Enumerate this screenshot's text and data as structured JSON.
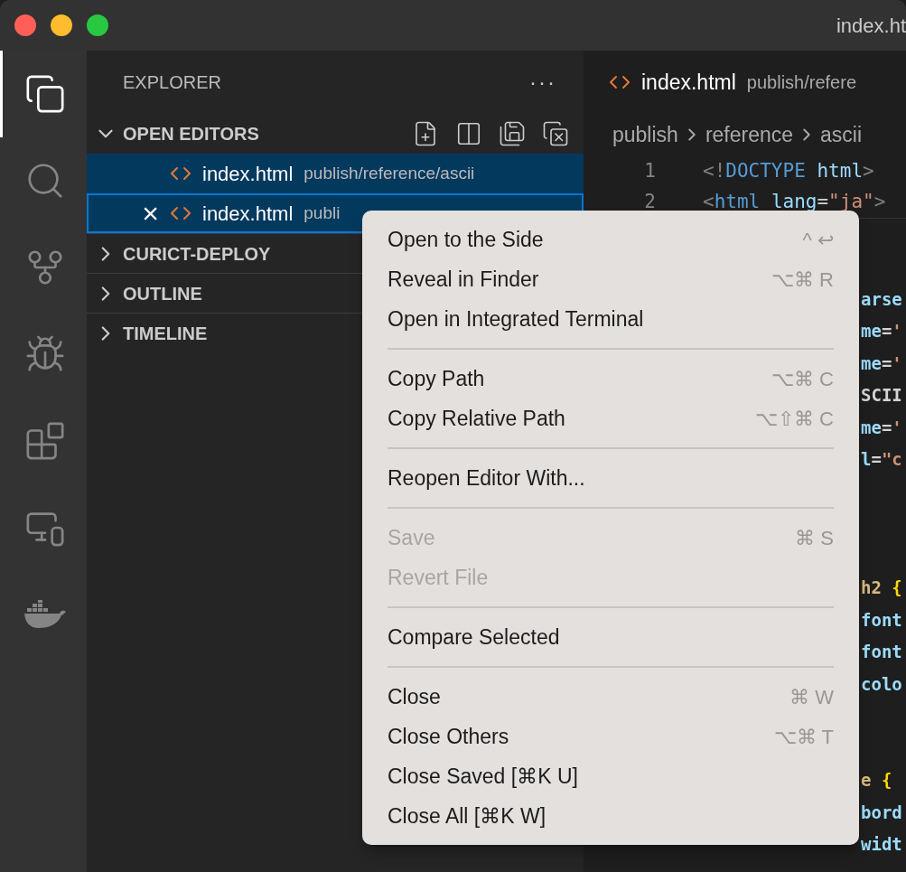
{
  "window": {
    "title": "index.ht"
  },
  "activity_bar": [
    {
      "kind": "explorer",
      "selected": true
    },
    {
      "kind": "search",
      "selected": false
    },
    {
      "kind": "git",
      "selected": false
    },
    {
      "kind": "debug",
      "selected": false
    },
    {
      "kind": "extensions",
      "selected": false
    },
    {
      "kind": "remote",
      "selected": false
    },
    {
      "kind": "docker",
      "selected": false
    }
  ],
  "sidebar": {
    "title": "EXPLORER",
    "more": "···",
    "open_editors": {
      "title": "OPEN EDITORS",
      "expanded": true,
      "items": [
        {
          "name": "index.html",
          "path": "publish/reference/ascii",
          "selected": true,
          "focused": false
        },
        {
          "name": "index.html",
          "path": "publi",
          "selected": true,
          "focused": true,
          "close": "×"
        }
      ]
    },
    "sections": [
      {
        "title": "CURICT-DEPLOY",
        "expanded": false
      },
      {
        "title": "OUTLINE",
        "expanded": false
      },
      {
        "title": "TIMELINE",
        "expanded": false
      }
    ]
  },
  "editor": {
    "tab": {
      "name": "index.html",
      "path": "publish/refere"
    },
    "breadcrumbs": [
      "publish",
      "reference",
      "ascii"
    ],
    "lines": [
      {
        "kind": "full",
        "number": "1",
        "tokens": [
          {
            "text": "<!",
            "color": "#808080"
          },
          {
            "text": "DOCTYPE",
            "color": "#569cd6"
          },
          {
            "text": " html",
            "color": "#9cdcfe"
          },
          {
            "text": ">",
            "color": "#808080"
          }
        ]
      },
      {
        "kind": "full",
        "number": "2",
        "tokens": [
          {
            "text": "<",
            "color": "#808080"
          },
          {
            "text": "html",
            "color": "#569cd6"
          },
          {
            "text": " lang",
            "color": "#9cdcfe"
          },
          {
            "text": "=",
            "color": "#d4d4d4"
          },
          {
            "text": "\"ja\"",
            "color": "#ce9178"
          },
          {
            "text": ">",
            "color": "#808080"
          }
        ]
      },
      {
        "kind": "blank"
      },
      {
        "kind": "blank"
      },
      {
        "kind": "fragment",
        "tokens": [
          {
            "text": "arse",
            "color": "#9cdcfe"
          }
        ]
      },
      {
        "kind": "fragment",
        "tokens": [
          {
            "text": "me",
            "color": "#9cdcfe"
          },
          {
            "text": "=",
            "color": "#d4d4d4"
          },
          {
            "text": "'",
            "color": "#ce9178"
          }
        ]
      },
      {
        "kind": "fragment",
        "tokens": [
          {
            "text": "me",
            "color": "#9cdcfe"
          },
          {
            "text": "=",
            "color": "#d4d4d4"
          },
          {
            "text": "'",
            "color": "#ce9178"
          }
        ]
      },
      {
        "kind": "fragment",
        "tokens": [
          {
            "text": "SCII",
            "color": "#d4d4d4"
          }
        ]
      },
      {
        "kind": "fragment",
        "tokens": [
          {
            "text": "me",
            "color": "#9cdcfe"
          },
          {
            "text": "=",
            "color": "#d4d4d4"
          },
          {
            "text": "'",
            "color": "#ce9178"
          }
        ]
      },
      {
        "kind": "fragment",
        "tokens": [
          {
            "text": "l",
            "color": "#9cdcfe"
          },
          {
            "text": "=",
            "color": "#d4d4d4"
          },
          {
            "text": "\"c",
            "color": "#ce9178"
          }
        ]
      },
      {
        "kind": "blank"
      },
      {
        "kind": "blank"
      },
      {
        "kind": "blank"
      },
      {
        "kind": "fragment",
        "tokens": [
          {
            "text": "h2 ",
            "color": "#d7ba7d"
          },
          {
            "text": "{",
            "color": "#ffd700"
          }
        ]
      },
      {
        "kind": "fragment",
        "tokens": [
          {
            "text": "font",
            "color": "#9cdcfe"
          }
        ]
      },
      {
        "kind": "fragment",
        "tokens": [
          {
            "text": "font",
            "color": "#9cdcfe"
          }
        ]
      },
      {
        "kind": "fragment",
        "tokens": [
          {
            "text": "colo",
            "color": "#9cdcfe"
          }
        ]
      },
      {
        "kind": "blank"
      },
      {
        "kind": "blank"
      },
      {
        "kind": "fragment",
        "tokens": [
          {
            "text": "e ",
            "color": "#d7ba7d"
          },
          {
            "text": "{",
            "color": "#ffd700"
          }
        ]
      },
      {
        "kind": "fragment",
        "tokens": [
          {
            "text": "bord",
            "color": "#9cdcfe"
          }
        ]
      },
      {
        "kind": "fragment",
        "tokens": [
          {
            "text": "widt",
            "color": "#9cdcfe"
          }
        ]
      }
    ]
  },
  "context_menu": {
    "groups": [
      [
        {
          "label": "Open to the Side",
          "shortcut": "^ ↩",
          "disabled": false
        },
        {
          "label": "Reveal in Finder",
          "shortcut": "⌥⌘ R",
          "disabled": false
        },
        {
          "label": "Open in Integrated Terminal",
          "disabled": false
        }
      ],
      [
        {
          "label": "Copy Path",
          "shortcut": "⌥⌘ C",
          "disabled": false
        },
        {
          "label": "Copy Relative Path",
          "shortcut": "⌥⇧⌘ C",
          "disabled": false
        }
      ],
      [
        {
          "label": "Reopen Editor With...",
          "disabled": false
        }
      ],
      [
        {
          "label": "Save",
          "shortcut": "⌘ S",
          "disabled": true
        },
        {
          "label": "Revert File",
          "disabled": true
        }
      ],
      [
        {
          "label": "Compare Selected",
          "disabled": false
        }
      ],
      [
        {
          "label": "Close",
          "shortcut": "⌘ W",
          "disabled": false
        },
        {
          "label": "Close Others",
          "shortcut": "⌥⌘ T",
          "disabled": false
        },
        {
          "label": "Close Saved [⌘K U]",
          "disabled": false
        },
        {
          "label": "Close All [⌘K W]",
          "disabled": false
        }
      ]
    ]
  }
}
